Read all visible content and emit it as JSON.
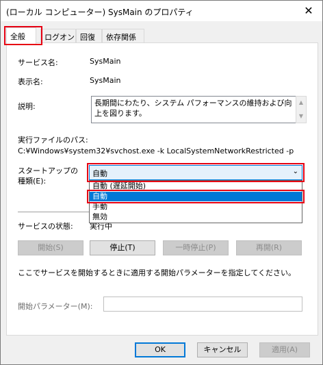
{
  "window": {
    "title": "(ローカル コンピューター) SysMain のプロパティ",
    "close_glyph": "✕"
  },
  "tabs": [
    {
      "label": "全般"
    },
    {
      "label": "ログオン"
    },
    {
      "label": "回復"
    },
    {
      "label": "依存関係"
    }
  ],
  "general": {
    "service_name_label": "サービス名:",
    "service_name_value": "SysMain",
    "display_name_label": "表示名:",
    "display_name_value": "SysMain",
    "description_label": "説明:",
    "description_value": "長期間にわたり、システム パフォーマンスの維持および向上を図ります。",
    "path_label": "実行ファイルのパス:",
    "path_value": "C:¥Windows¥system32¥svchost.exe -k LocalSystemNetworkRestricted -p",
    "startup_label_line1": "スタートアップの",
    "startup_label_line2": "種類(E):",
    "startup_selected": "自動",
    "startup_options": [
      "自動 (遅延開始)",
      "自動",
      "手動",
      "無効"
    ],
    "status_label": "サービスの状態:",
    "status_value": "実行中",
    "buttons": {
      "start": "開始(S)",
      "stop": "停止(T)",
      "pause": "一時停止(P)",
      "resume": "再開(R)"
    },
    "hint_text": "ここでサービスを開始するときに適用する開始パラメーターを指定してください。",
    "params_label": "開始パラメーター(M):",
    "params_value": ""
  },
  "footer": {
    "ok": "OK",
    "cancel": "キャンセル",
    "apply": "適用(A)"
  },
  "colors": {
    "highlight": "#e60012",
    "accent": "#0078d7"
  },
  "icons": {
    "scroll_up": "▲",
    "scroll_down": "▼",
    "combo_arrow": "⌄"
  }
}
